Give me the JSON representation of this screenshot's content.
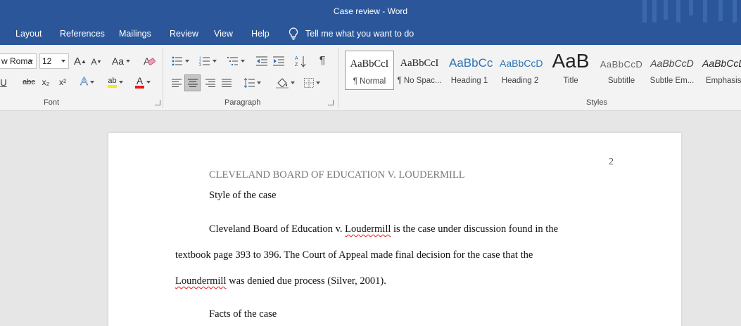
{
  "window": {
    "title": "Case review  -  Word"
  },
  "menu": {
    "tabs": [
      "Layout",
      "References",
      "Mailings",
      "Review",
      "View",
      "Help"
    ],
    "tell_me": "Tell me what you want to do"
  },
  "ribbon": {
    "font": {
      "group_label": "Font",
      "font_name": "w Roma",
      "font_size": "12",
      "grow": "A",
      "shrink": "A",
      "change_case": "Aa",
      "underline": "U",
      "strikethrough": "abc",
      "subscript": "x₂",
      "superscript": "x²",
      "text_effects": "A",
      "highlight": "ab",
      "font_color": "A"
    },
    "paragraph": {
      "group_label": "Paragraph",
      "pilcrow": "¶"
    },
    "styles": {
      "group_label": "Styles",
      "items": [
        {
          "sample": "AaBbCcI",
          "label": "¶ Normal"
        },
        {
          "sample": "AaBbCcI",
          "label": "¶ No Spac..."
        },
        {
          "sample": "AaBbCc",
          "label": "Heading 1"
        },
        {
          "sample": "AaBbCcD",
          "label": "Heading 2"
        },
        {
          "sample": "AaB",
          "label": "Title"
        },
        {
          "sample": "AaBbCcD",
          "label": "Subtitle"
        },
        {
          "sample": "AaBbCcD",
          "label": "Subtle Em..."
        },
        {
          "sample": "AaBbCcD",
          "label": "Emphasis"
        }
      ]
    }
  },
  "document": {
    "page_number": "2",
    "running_head": "CLEVELAND BOARD OF EDUCATION V. LOUDERMILL",
    "heading_style": "Style of the case",
    "p1_line1_a": "Cleveland Board of Education v. ",
    "p1_line1_misspelled": "Loudermill",
    "p1_line1_b": " is the case under discussion found in the",
    "p1_line2": "textbook page 393 to 396. The Court of Appeal made final decision for the case that the",
    "p1_line3_misspelled": "Loundermill",
    "p1_line3_b": " was denied due process (Silver, 2001).",
    "heading_facts": "Facts of the case"
  },
  "colors": {
    "brand": "#2b579a",
    "page": "#ffffff",
    "canvas": "#e6e6e6",
    "spelling_error": "#dd2222"
  }
}
